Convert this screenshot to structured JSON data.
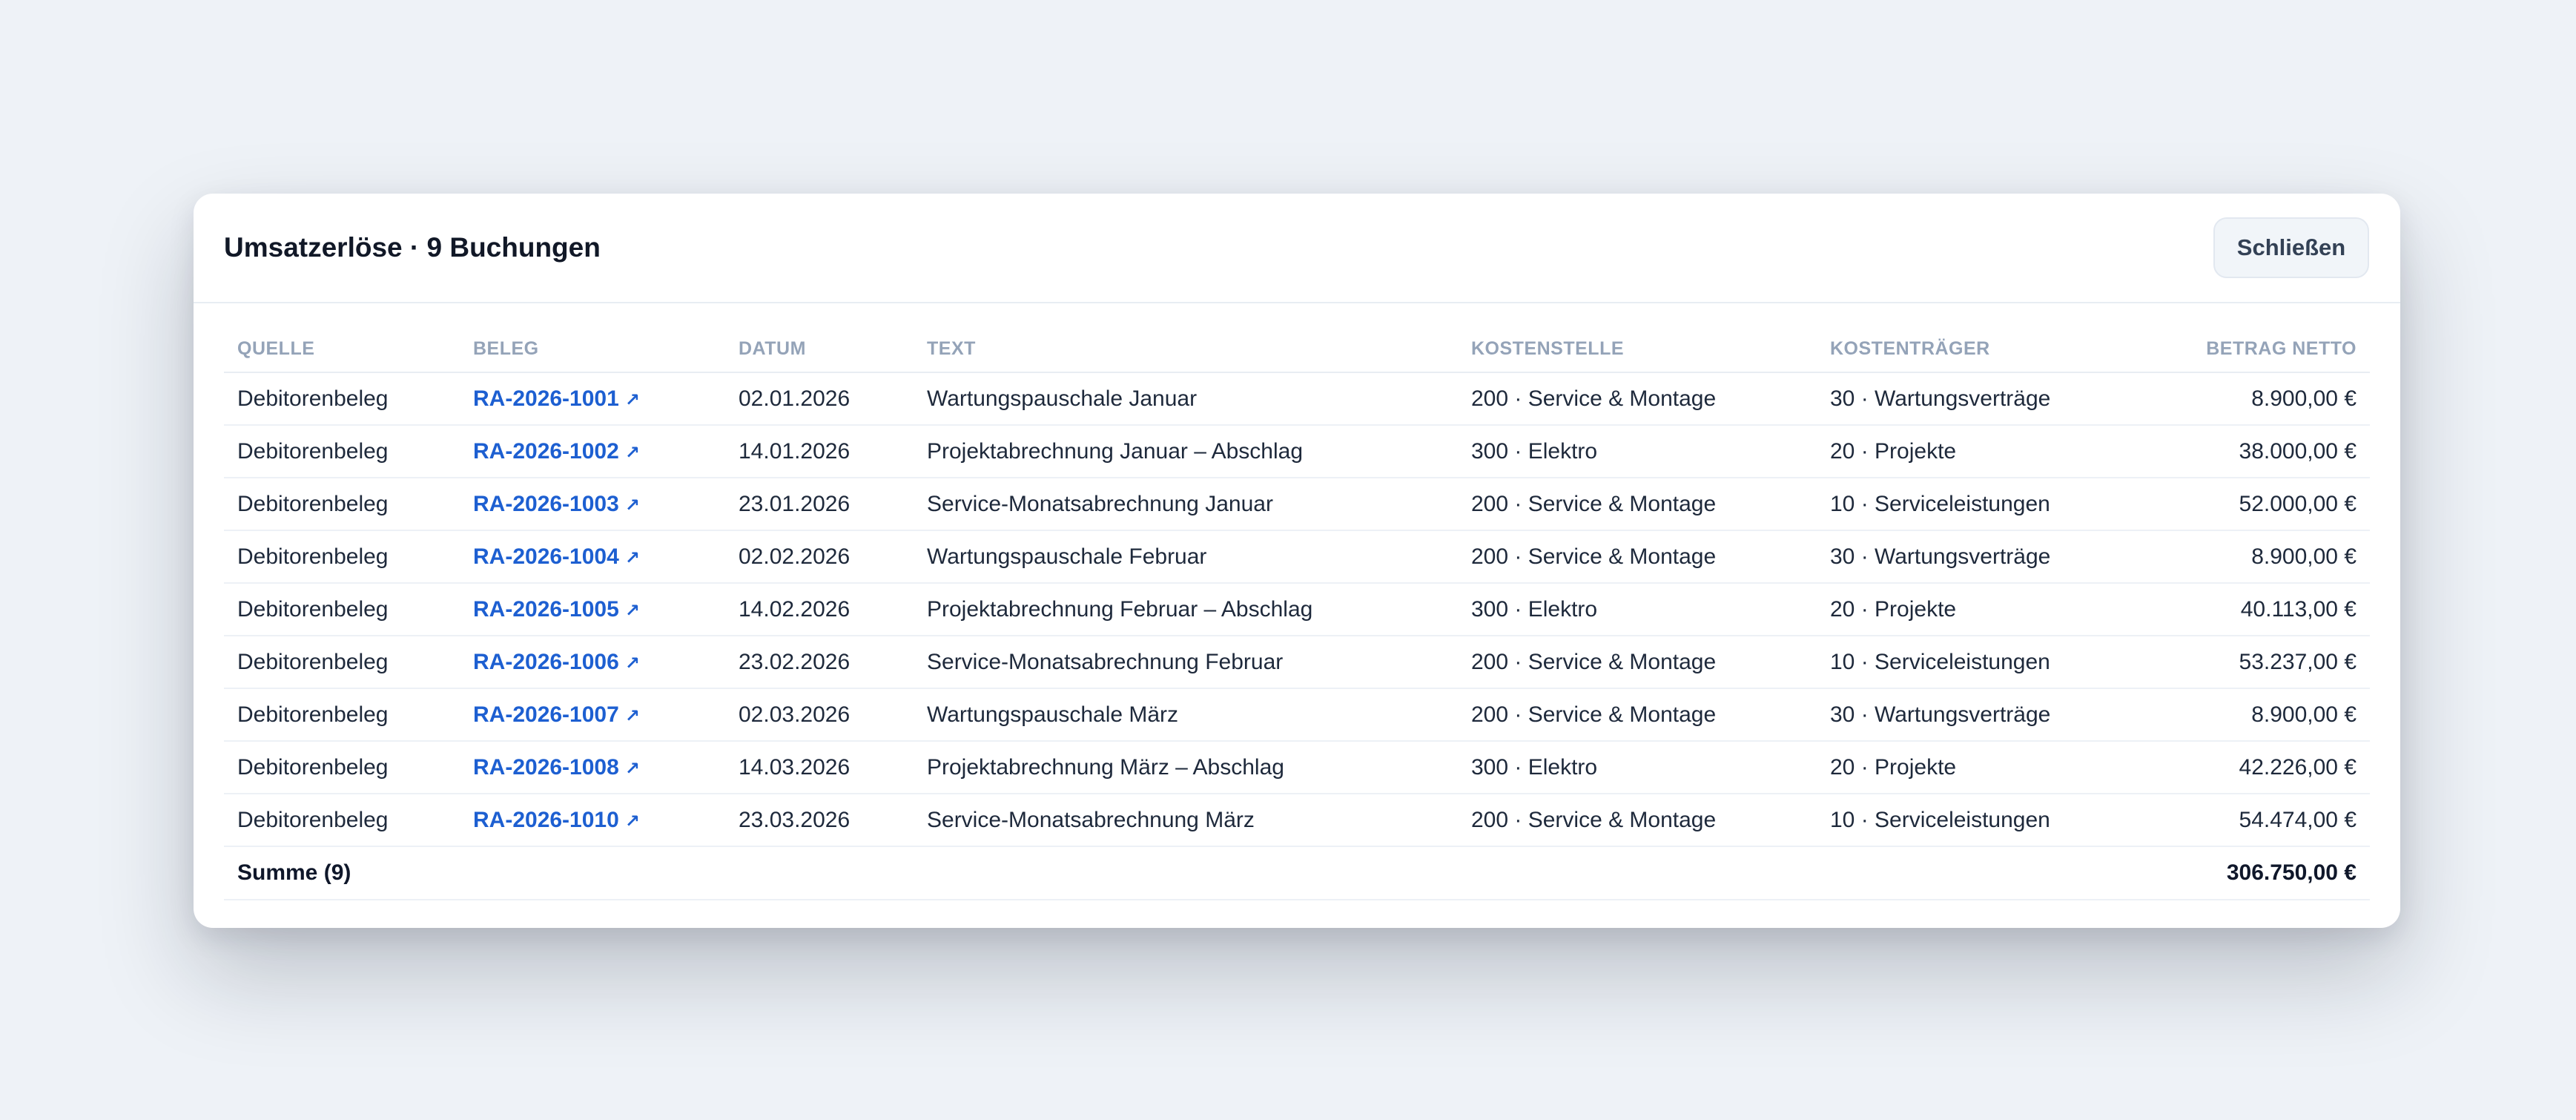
{
  "modal": {
    "title": "Umsatzerlöse · 9 Buchungen",
    "close_label": "Schließen"
  },
  "table": {
    "columns": [
      "QUELLE",
      "BELEG",
      "DATUM",
      "TEXT",
      "KOSTENSTELLE",
      "KOSTENTRÄGER",
      "BETRAG NETTO"
    ],
    "rows": [
      {
        "quelle": "Debitorenbeleg",
        "beleg": "RA-2026-1001",
        "datum": "02.01.2026",
        "text": "Wartungspauschale Januar",
        "kostenstelle": "200 · Service & Montage",
        "kostentraeger": "30 · Wartungsverträge",
        "betrag": "8.900,00 €"
      },
      {
        "quelle": "Debitorenbeleg",
        "beleg": "RA-2026-1002",
        "datum": "14.01.2026",
        "text": "Projektabrechnung Januar – Abschlag",
        "kostenstelle": "300 · Elektro",
        "kostentraeger": "20 · Projekte",
        "betrag": "38.000,00 €"
      },
      {
        "quelle": "Debitorenbeleg",
        "beleg": "RA-2026-1003",
        "datum": "23.01.2026",
        "text": "Service-Monatsabrechnung Januar",
        "kostenstelle": "200 · Service & Montage",
        "kostentraeger": "10 · Serviceleistungen",
        "betrag": "52.000,00 €"
      },
      {
        "quelle": "Debitorenbeleg",
        "beleg": "RA-2026-1004",
        "datum": "02.02.2026",
        "text": "Wartungspauschale Februar",
        "kostenstelle": "200 · Service & Montage",
        "kostentraeger": "30 · Wartungsverträge",
        "betrag": "8.900,00 €"
      },
      {
        "quelle": "Debitorenbeleg",
        "beleg": "RA-2026-1005",
        "datum": "14.02.2026",
        "text": "Projektabrechnung Februar – Abschlag",
        "kostenstelle": "300 · Elektro",
        "kostentraeger": "20 · Projekte",
        "betrag": "40.113,00 €"
      },
      {
        "quelle": "Debitorenbeleg",
        "beleg": "RA-2026-1006",
        "datum": "23.02.2026",
        "text": "Service-Monatsabrechnung Februar",
        "kostenstelle": "200 · Service & Montage",
        "kostentraeger": "10 · Serviceleistungen",
        "betrag": "53.237,00 €"
      },
      {
        "quelle": "Debitorenbeleg",
        "beleg": "RA-2026-1007",
        "datum": "02.03.2026",
        "text": "Wartungspauschale März",
        "kostenstelle": "200 · Service & Montage",
        "kostentraeger": "30 · Wartungsverträge",
        "betrag": "8.900,00 €"
      },
      {
        "quelle": "Debitorenbeleg",
        "beleg": "RA-2026-1008",
        "datum": "14.03.2026",
        "text": "Projektabrechnung März – Abschlag",
        "kostenstelle": "300 · Elektro",
        "kostentraeger": "20 · Projekte",
        "betrag": "42.226,00 €"
      },
      {
        "quelle": "Debitorenbeleg",
        "beleg": "RA-2026-1010",
        "datum": "23.03.2026",
        "text": "Service-Monatsabrechnung März",
        "kostenstelle": "200 · Service & Montage",
        "kostentraeger": "10 · Serviceleistungen",
        "betrag": "54.474,00 €"
      }
    ],
    "summary": {
      "label": "Summe (9)",
      "total": "306.750,00 €"
    }
  },
  "icons": {
    "beleg_link": "external-link-icon"
  },
  "colors": {
    "background": "#eef2f7",
    "link": "#1d5fd1",
    "header_text": "#94a3b8",
    "title": "#111827"
  }
}
